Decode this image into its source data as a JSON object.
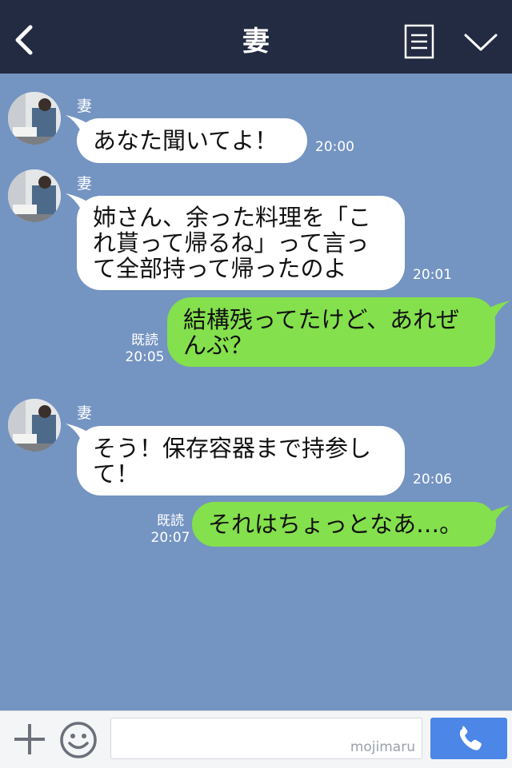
{
  "header": {
    "title": "妻"
  },
  "messages": [
    {
      "sender": "妻",
      "text": "あなた聞いてよ！",
      "time": "20:00"
    },
    {
      "sender": "妻",
      "text": "姉さん、余った料理を「こ\nれ貰って帰るね」って言っ\nて全部持って帰ったのよ",
      "time": "20:01"
    },
    {
      "text": "結構残ってたけど、あれぜ\nんぶ？",
      "read": "既読",
      "time": "20:05"
    },
    {
      "sender": "妻",
      "text": "そう！保存容器まで持参し\nて！",
      "time": "20:06"
    },
    {
      "text": "それはちょっとなあ…。",
      "read": "既読",
      "time": "20:07"
    }
  ],
  "footer": {
    "watermark": "mojimaru"
  },
  "colors": {
    "header_bg": "#232b42",
    "chat_bg": "#7494c2",
    "incoming_bubble": "#ffffff",
    "outgoing_bubble": "#84e04c",
    "call_button": "#4c86e6"
  },
  "icons": {
    "back": "chevron-left-icon",
    "menu": "list-icon",
    "collapse": "chevron-down-icon",
    "plus": "plus-icon",
    "emoji": "smiley-icon",
    "call": "phone-icon"
  }
}
